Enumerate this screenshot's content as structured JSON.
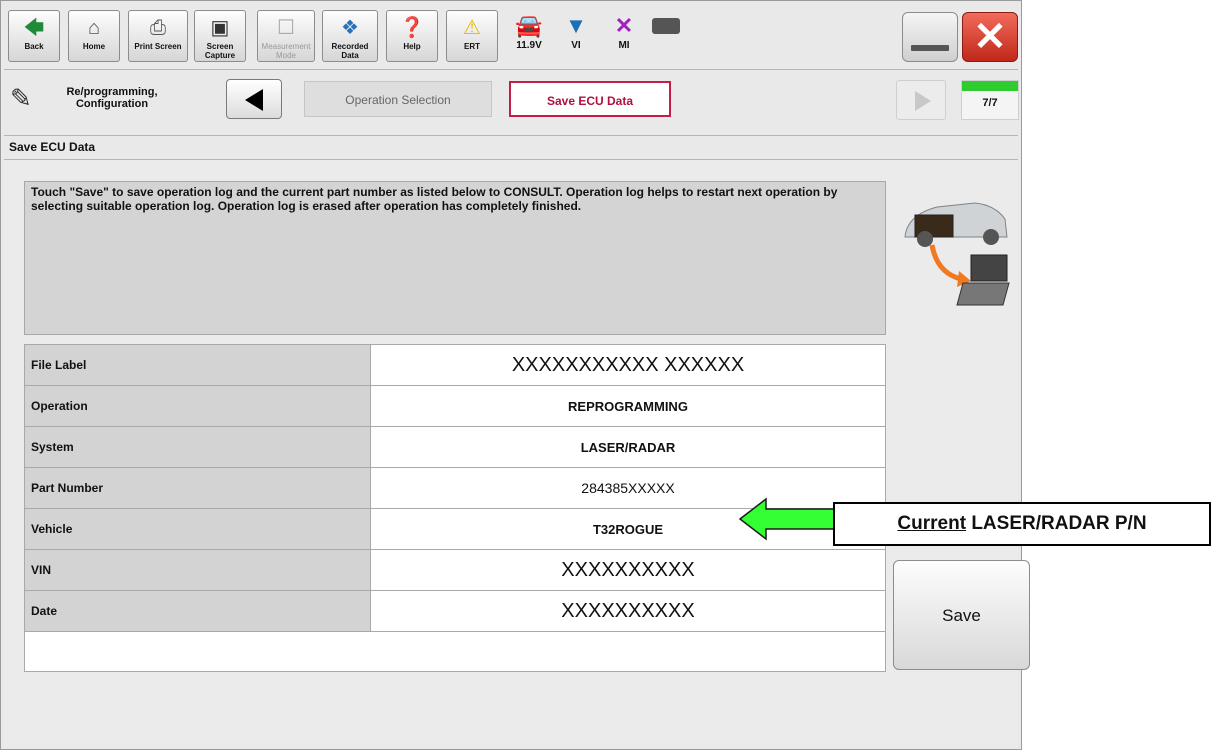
{
  "toolbar": {
    "back": "Back",
    "home": "Home",
    "print_screen": "Print Screen",
    "screen_capture": "Screen Capture",
    "measurement_mode": "Measurement Mode",
    "recorded_data": "Recorded Data",
    "help": "Help",
    "ert": "ERT",
    "voltage": "11.9V",
    "vi": "VI",
    "mi": "MI"
  },
  "breadcrumb": {
    "mode": "Re/programming, Configuration",
    "step_prev": "Operation Selection",
    "step_current": "Save ECU Data",
    "step_count": "7/7",
    "progress": 1.0
  },
  "section_title": "Save ECU Data",
  "message": "Touch \"Save\" to save operation log and the current part number as listed below to CONSULT. Operation log helps to restart next operation by selecting suitable operation log. Operation log is erased after operation has completely finished.",
  "table": {
    "rows": [
      {
        "label": "File Label",
        "value": "XXXXXXXXXXX XXXXXX"
      },
      {
        "label": "Operation",
        "value": "REPROGRAMMING"
      },
      {
        "label": "System",
        "value": "LASER/RADAR"
      },
      {
        "label": "Part Number",
        "value": "284385XXXXX"
      },
      {
        "label": "Vehicle",
        "value": "T32ROGUE"
      },
      {
        "label": "VIN",
        "value": "XXXXXXXXXX"
      },
      {
        "label": "Date",
        "value": "XXXXXXXXXX"
      }
    ]
  },
  "save_label": "Save",
  "annotation": {
    "emphasis": "Current",
    "rest": " LASER/RADAR P/N",
    "arrow_color": "#33ff33"
  }
}
